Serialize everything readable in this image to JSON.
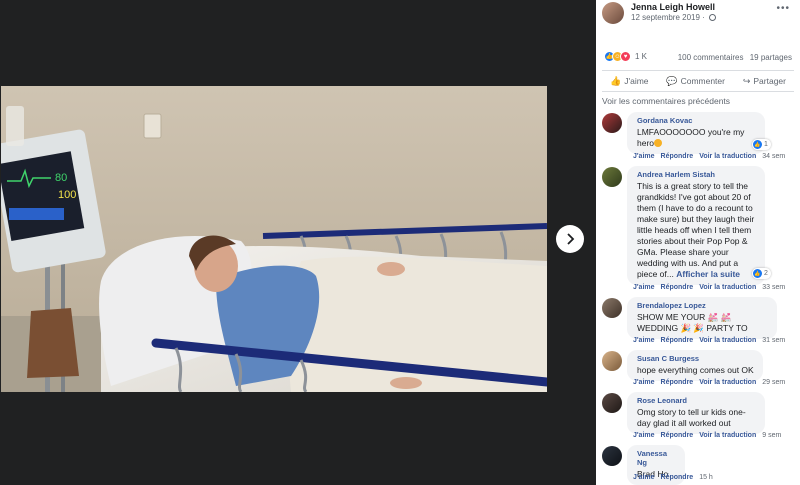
{
  "post": {
    "author": "Jenna Leigh Howell",
    "date": "12 septembre 2019 · ",
    "reactions_count": "1 K",
    "comments_count": "100 commentaires",
    "shares_count": "19 partages"
  },
  "actions": {
    "like": "J'aime",
    "comment": "Commenter",
    "share": "Partager"
  },
  "prev_comments": "Voir les commentaires précédents",
  "meta_labels": {
    "like": "J'aime",
    "reply": "Répondre",
    "translate": "Voir la traduction"
  },
  "comments": [
    {
      "name": "Gordana Kovac",
      "text": "LMFAOOOOOOO you're my hero",
      "time": "34 sem",
      "likes": "1"
    },
    {
      "name": "Andrea Harlem Sistah",
      "text": "This is a great story to tell the grandkids! I've got about 20 of them (I have to do a recount to make sure) but they laugh their little heads off when I tell them stories about their Pop Pop & GMa. Please share your wedding with us. And put a piece of...",
      "more": "Afficher la suite",
      "time": "33 sem",
      "likes": "2"
    },
    {
      "name": "Brendalopez Lopez",
      "text": "SHOW ME YOUR 💒 💒 WEDDING 🎉 🎉 PARTY TO",
      "time": "31 sem"
    },
    {
      "name": "Susan C Burgess",
      "text": "hope everything comes out OK",
      "time": "29 sem"
    },
    {
      "name": "Rose Leonard",
      "text": "Omg story to tell ur kids one-day glad it all worked out",
      "time": "9 sem"
    },
    {
      "name": "Vanessa Ng",
      "text": "Brad Ho",
      "time": "15 h"
    }
  ],
  "colors": {
    "link_blue": "#385898",
    "bubble_gray": "#f2f3f5",
    "like_blue": "#1877f2",
    "viewer_bg": "#202122"
  }
}
